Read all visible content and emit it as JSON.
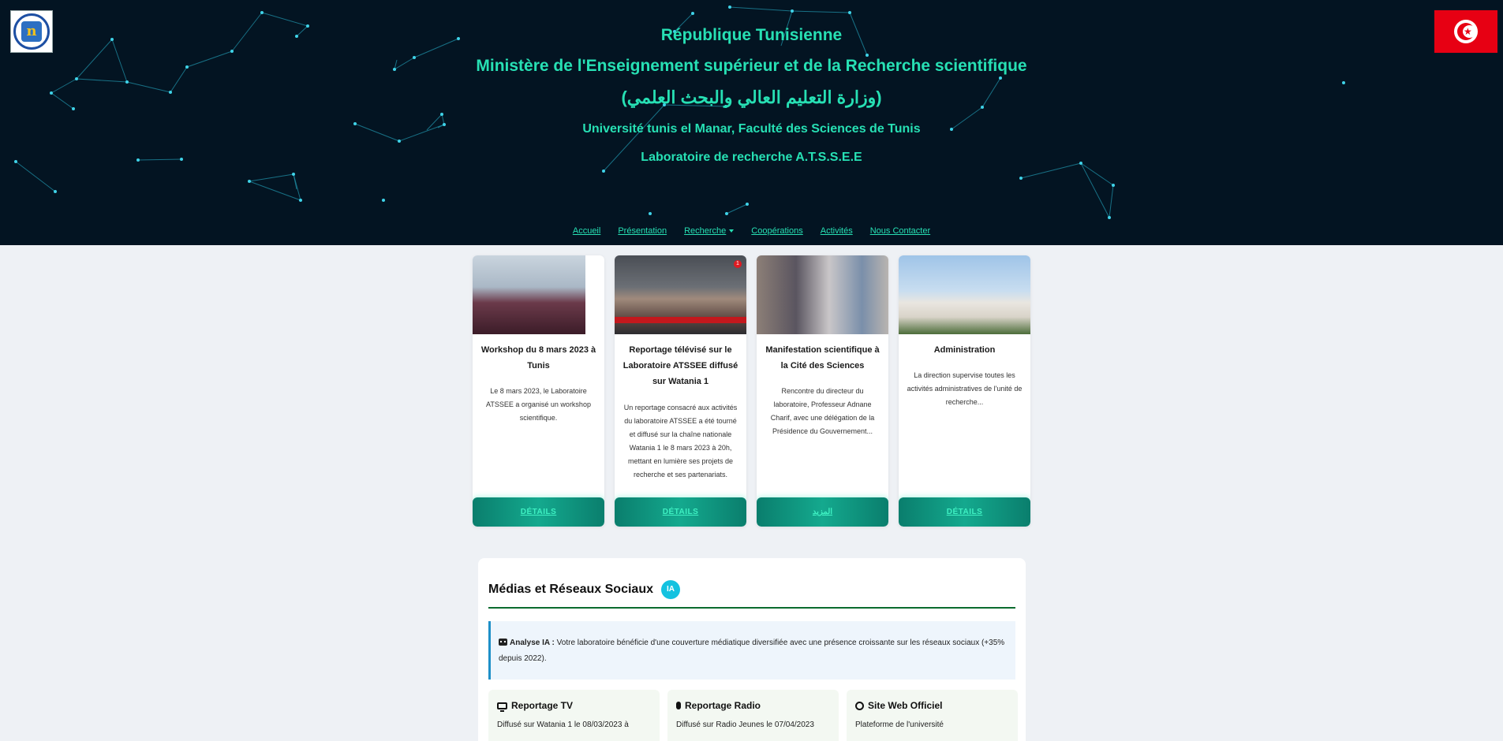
{
  "header": {
    "line1": "République Tunisienne",
    "line2": "Ministère de l'Enseignement supérieur et de la Recherche scientifique",
    "line3": "(وزارة التعليم العالي والبحث العلمي)",
    "line4": "Université tunis el Manar, Faculté des Sciences de Tunis",
    "line5": "Laboratoire de recherche A.T.S.S.E.E",
    "logo_text": "n"
  },
  "nav": {
    "items": [
      "Accueil",
      "Présentation",
      "Recherche",
      "Coopérations",
      "Activités",
      "Nous Contacter"
    ]
  },
  "cards": [
    {
      "title": "Workshop du 8 mars 2023 à Tunis",
      "text": "Le 8 mars 2023, le Laboratoire ATSSEE a organisé un workshop scientifique.",
      "button": "DÉTAILS"
    },
    {
      "title": "Reportage télévisé sur le Laboratoire ATSSEE diffusé sur Watania 1",
      "text": "Un reportage consacré aux activités du laboratoire ATSSEE a été tourné et diffusé sur la chaîne nationale Watania 1 le 8 mars 2023 à 20h, mettant en lumière ses projets de recherche et ses partenariats.",
      "button": "DÉTAILS"
    },
    {
      "title": "Manifestation scientifique à la Cité des Sciences",
      "text": "Rencontre du directeur du laboratoire, Professeur Adnane Charif, avec une délégation de la Présidence du Gouvernement...",
      "button": "المزيد"
    },
    {
      "title": "Administration",
      "text": "La direction supervise toutes les activités administratives de l'unité de recherche...",
      "button": "DÉTAILS"
    }
  ],
  "media": {
    "title": "Médias et Réseaux Sociaux",
    "badge": "IA",
    "analysis_label": "Analyse IA :",
    "analysis_text": " Votre laboratoire bénéficie d'une couverture médiatique diversifiée avec une présence croissante sur les réseaux sociaux (+35% depuis 2022).",
    "items": [
      {
        "icon": "tv-icon",
        "title": "Reportage TV",
        "text": "Diffusé sur Watania 1 le 08/03/2023 à"
      },
      {
        "icon": "microphone-icon",
        "title": "Reportage Radio",
        "text": "Diffusé sur Radio Jeunes le 07/04/2023"
      },
      {
        "icon": "globe-icon",
        "title": "Site Web Officiel",
        "text": "Plateforme de l'université"
      }
    ]
  },
  "colors": {
    "header_bg": "#031422",
    "accent_teal": "#27e0b4",
    "button_green": "#0a7e6d",
    "flag_red": "#e70013"
  }
}
